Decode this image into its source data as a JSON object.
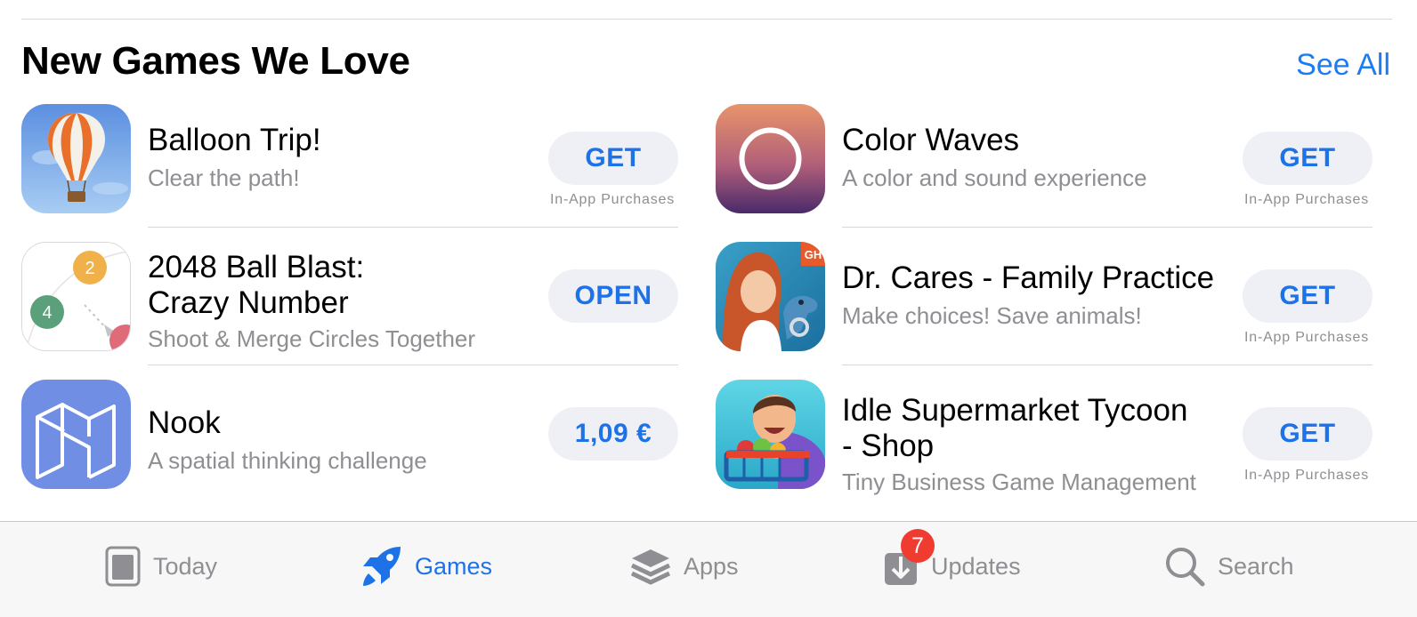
{
  "section": {
    "title": "New Games We Love",
    "see_all": "See All"
  },
  "apps_left": [
    {
      "name": "Balloon Trip!",
      "subtitle": "Clear the path!",
      "button": "GET",
      "iap": "In-App Purchases",
      "icon": "balloon-icon"
    },
    {
      "name": "2048 Ball Blast:\nCrazy Number",
      "subtitle": "Shoot & Merge Circles Together",
      "button": "OPEN",
      "iap": "",
      "icon": "ball-blast-icon",
      "icon_numbers": [
        "2",
        "4"
      ]
    },
    {
      "name": "Nook",
      "subtitle": "A spatial thinking challenge",
      "button": "1,09 €",
      "iap": "",
      "icon": "nook-icon"
    }
  ],
  "apps_right": [
    {
      "name": "Color Waves",
      "subtitle": "A color and sound experience",
      "button": "GET",
      "iap": "In-App Purchases",
      "icon": "color-waves-icon"
    },
    {
      "name": "Dr. Cares - Family Practice",
      "subtitle": "Make choices! Save animals!",
      "button": "GET",
      "iap": "In-App Purchases",
      "icon": "dr-cares-icon",
      "icon_badge": "GH"
    },
    {
      "name": "Idle Supermarket Tycoon\n- Shop",
      "subtitle": "Tiny Business Game Management",
      "button": "GET",
      "iap": "In-App Purchases",
      "icon": "supermarket-icon"
    }
  ],
  "tabbar": {
    "tabs": [
      {
        "label": "Today",
        "icon": "today-icon",
        "active": false
      },
      {
        "label": "Games",
        "icon": "rocket-icon",
        "active": true
      },
      {
        "label": "Apps",
        "icon": "layers-icon",
        "active": false
      },
      {
        "label": "Updates",
        "icon": "download-icon",
        "active": false,
        "badge": "7"
      },
      {
        "label": "Search",
        "icon": "search-icon",
        "active": false
      }
    ]
  },
  "colors": {
    "accent": "#1d72e8",
    "badge": "#f03b30",
    "secondary_text": "#8e8e93",
    "button_bg": "#eff0f5"
  }
}
